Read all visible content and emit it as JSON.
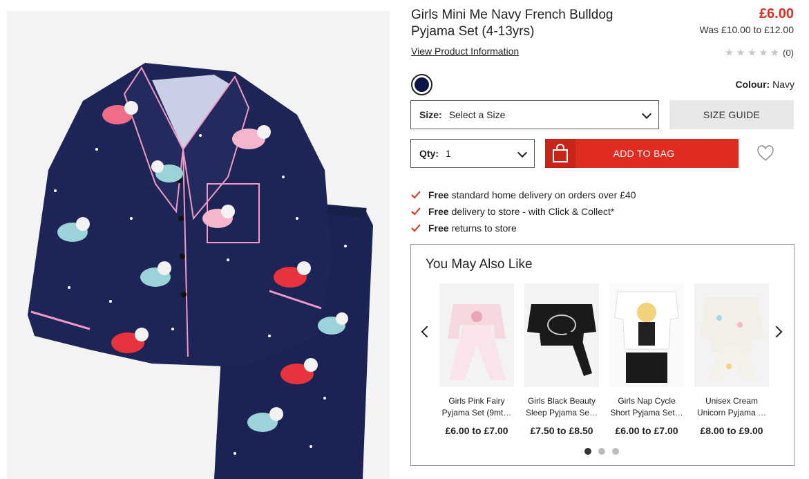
{
  "product": {
    "title": "Girls Mini Me Navy French Bulldog Pyjama Set (4-13yrs)",
    "price_now": "£6.00",
    "price_was": "Was £10.00 to £12.00",
    "view_info_link": "View Product Information",
    "rating_stars": 0,
    "rating_max": 5,
    "review_count": "(0)",
    "colour_label": "Colour:",
    "colour_value": "Navy",
    "swatch_color": "#0d1446"
  },
  "size": {
    "label": "Size:",
    "value": "Select a Size",
    "guide_label": "SIZE GUIDE"
  },
  "qty": {
    "label": "Qty:",
    "value": "1"
  },
  "add_to_bag": {
    "label": "ADD TO BAG",
    "color": "#e02b20"
  },
  "delivery": [
    {
      "bold": "Free",
      "text": "standard home delivery on orders over £40"
    },
    {
      "bold": "Free",
      "text": "delivery to store - with Click & Collect*"
    },
    {
      "bold": "Free",
      "text": "returns to store"
    }
  ],
  "ymal": {
    "heading": "You May Also Like",
    "items": [
      {
        "name": "Girls Pink Fairy Pyjama Set (9mt…",
        "price": "£6.00 to £7.00"
      },
      {
        "name": "Girls Black Beauty Sleep Pyjama Se…",
        "price": "£7.50 to £8.50"
      },
      {
        "name": "Girls Nap Cycle Short Pyjama Set…",
        "price": "£6.00 to £7.00"
      },
      {
        "name": "Unisex Cream Unicorn Pyjama …",
        "price": "£8.00 to £9.00"
      }
    ],
    "page_count": 3,
    "active_page": 1
  },
  "icons": {
    "bag": "shopping-bag-icon",
    "wishlist": "heart-icon",
    "tick": "check-icon",
    "star": "star-icon"
  }
}
